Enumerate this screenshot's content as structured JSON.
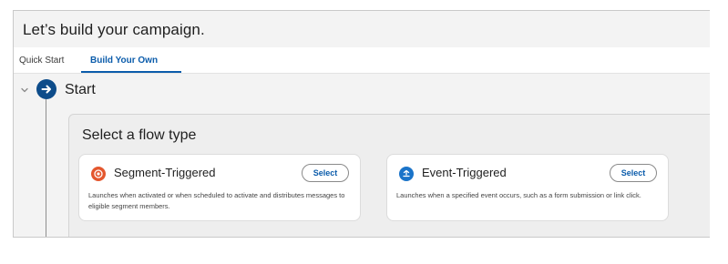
{
  "header": {
    "title": "Let’s build your campaign."
  },
  "tabs": [
    {
      "label": "Quick Start",
      "active": false
    },
    {
      "label": "Build Your Own",
      "active": true
    }
  ],
  "flow": {
    "start_label": "Start",
    "panel_title": "Select a flow type",
    "cards": [
      {
        "title": "Segment-Triggered",
        "select_label": "Select",
        "description": "Launches when activated or when scheduled to activate and distributes messages to eligible segment members.",
        "icon": "target-icon",
        "icon_color": "#e4572e"
      },
      {
        "title": "Event-Triggered",
        "select_label": "Select",
        "description": "Launches when a specified event occurs, such as a form submission or link click.",
        "icon": "event-icon",
        "icon_color": "#1b74c9"
      }
    ]
  },
  "colors": {
    "accent": "#0b5cab",
    "start_circle": "#0d4c8a"
  }
}
